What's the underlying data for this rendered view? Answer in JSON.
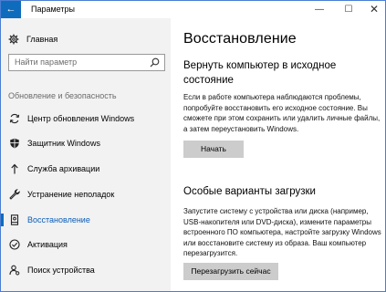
{
  "window": {
    "title": "Параметры",
    "back_icon": "arrow-left-icon",
    "controls": {
      "minimize": "—",
      "maximize": "☐",
      "close": "✕"
    },
    "accent_color": "#0f6cbd"
  },
  "sidebar": {
    "home_label": "Главная",
    "search_placeholder": "Найти параметр",
    "section_label": "Обновление и безопасность",
    "items": [
      {
        "label": "Центр обновления Windows",
        "icon": "sync-icon"
      },
      {
        "label": "Защитник Windows",
        "icon": "shield-icon"
      },
      {
        "label": "Служба архивации",
        "icon": "backup-arrow-icon"
      },
      {
        "label": "Устранение неполадок",
        "icon": "wrench-icon"
      },
      {
        "label": "Восстановление",
        "icon": "recovery-icon",
        "active": true
      },
      {
        "label": "Активация",
        "icon": "check-circle-icon"
      },
      {
        "label": "Поиск устройства",
        "icon": "person-location-icon"
      }
    ]
  },
  "main": {
    "title": "Восстановление",
    "reset": {
      "heading": "Вернуть компьютер в исходное состояние",
      "description": "Если в работе компьютера наблюдаются проблемы, попробуйте восстановить его исходное состояние. Вы сможете при этом сохранить или удалить личные файлы, а затем переустановить Windows.",
      "button": "Начать"
    },
    "advanced": {
      "heading": "Особые варианты загрузки",
      "description": "Запустите систему с устройства или диска (например, USB-накопителя или DVD-диска), измените параметры встроенного ПО компьютера, настройте загрузку Windows или восстановите систему из образа. Ваш компьютер перезагрузится.",
      "button": "Перезагрузить сейчас"
    }
  }
}
